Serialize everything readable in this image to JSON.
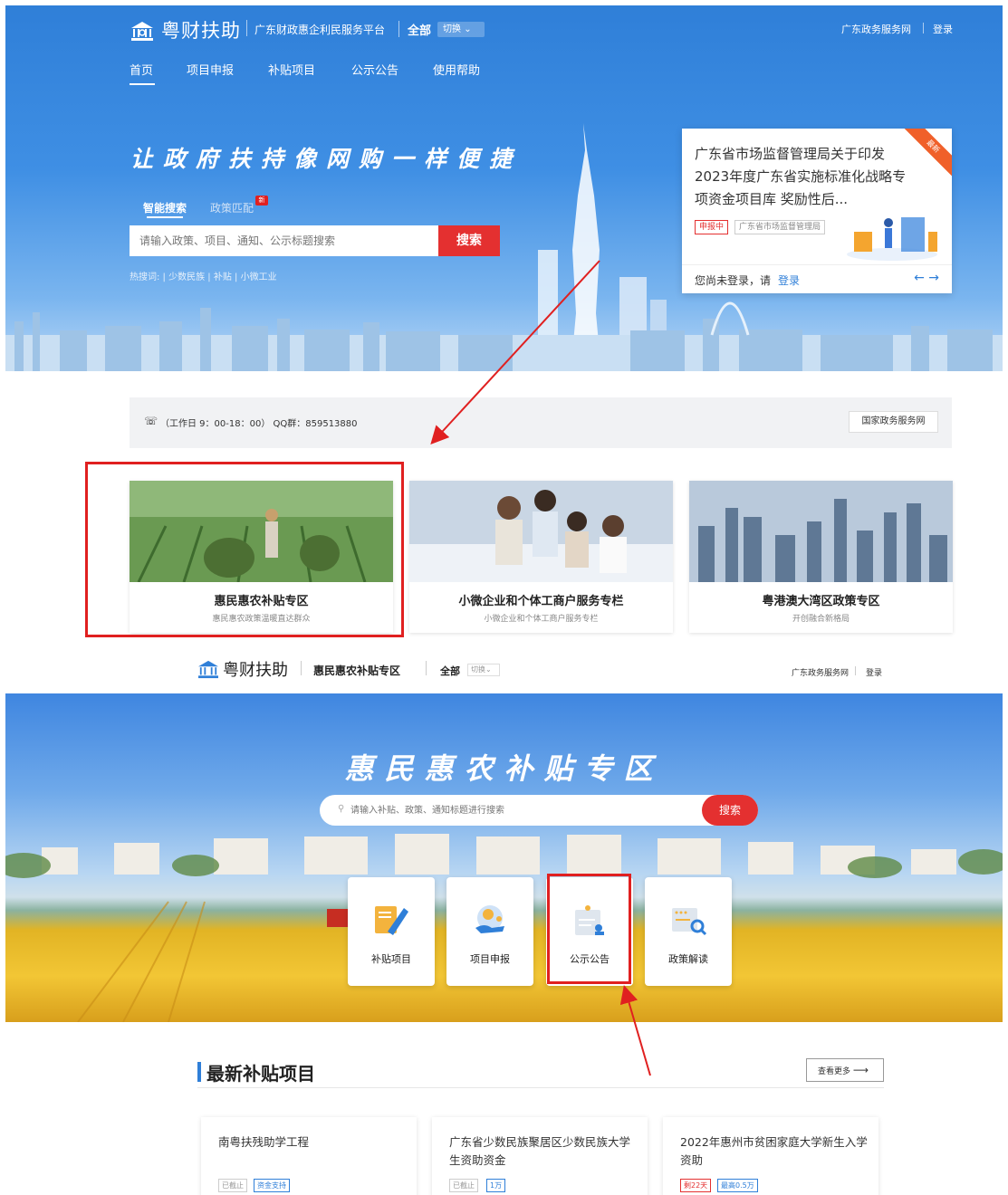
{
  "top": {
    "brand": {
      "name": "粤财扶助",
      "subtitle": "广东财政惠企利民服务平台",
      "scope": "全部",
      "switch_label": "切换"
    },
    "top_right": {
      "gov_link": "广东政务服务网",
      "login": "登录"
    },
    "nav": [
      "首页",
      "项目申报",
      "补贴项目",
      "公示公告",
      "使用帮助"
    ],
    "hero": {
      "slogan": "让政府扶持像网购一样便捷",
      "tabs": [
        "智能搜索",
        "政策匹配"
      ],
      "new_badge": "新",
      "search_placeholder": "请输入政策、项目、通知、公示标题搜索",
      "search_button": "搜索",
      "hot_label": "热搜词:",
      "hot_words": [
        "少数民族",
        "补贴",
        "小微工业"
      ]
    },
    "notice": {
      "title": "广东省市场监督管理局关于印发2023年度广东省实施标准化战略专项资金项目库 奖励性后...",
      "ribbon": "最新",
      "status_tag": "申报中",
      "dept_tag": "广东省市场监督管理局",
      "login_tip": "您尚未登录，请",
      "login_link": "登录",
      "arrows": "←  →"
    },
    "info_bar": {
      "text": "（工作日 9：00-18：00） QQ群：859513880",
      "button": "国家政务服务网"
    },
    "cards": [
      {
        "title": "惠民惠农补贴专区",
        "subtitle": "惠民惠农政策温暖直达群众"
      },
      {
        "title": "小微企业和个体工商户服务专栏",
        "subtitle": "小微企业和个体工商户服务专栏"
      },
      {
        "title": "粤港澳大湾区政策专区",
        "subtitle": "开创融合新格局"
      }
    ]
  },
  "bottom": {
    "header": {
      "brand": "粤财扶助",
      "zone": "惠民惠农补贴专区",
      "scope": "全部",
      "switch_label": "切换",
      "gov_link": "广东政务服务网",
      "login": "登录"
    },
    "hero": {
      "title": "惠民惠农补贴专区",
      "search_placeholder": "请输入补贴、政策、通知标题进行搜索",
      "search_button": "搜索"
    },
    "quick_links": [
      "补贴项目",
      "项目申报",
      "公示公告",
      "政策解读"
    ],
    "section": {
      "title": "最新补贴项目",
      "more": "查看更多"
    },
    "projects": [
      {
        "title": "南粤扶残助学工程",
        "tags": [
          "已截止",
          "资金支持"
        ]
      },
      {
        "title": "广东省少数民族聚居区少数民族大学生资助资金",
        "tags": [
          "已截止",
          "1万"
        ]
      },
      {
        "title": "2022年惠州市贫困家庭大学新生入学资助",
        "tags": [
          "剩22天",
          "最高0.5万"
        ]
      }
    ]
  },
  "colors": {
    "primary": "#2f7fd8",
    "danger": "#e43030",
    "highlight": "#e02020"
  }
}
